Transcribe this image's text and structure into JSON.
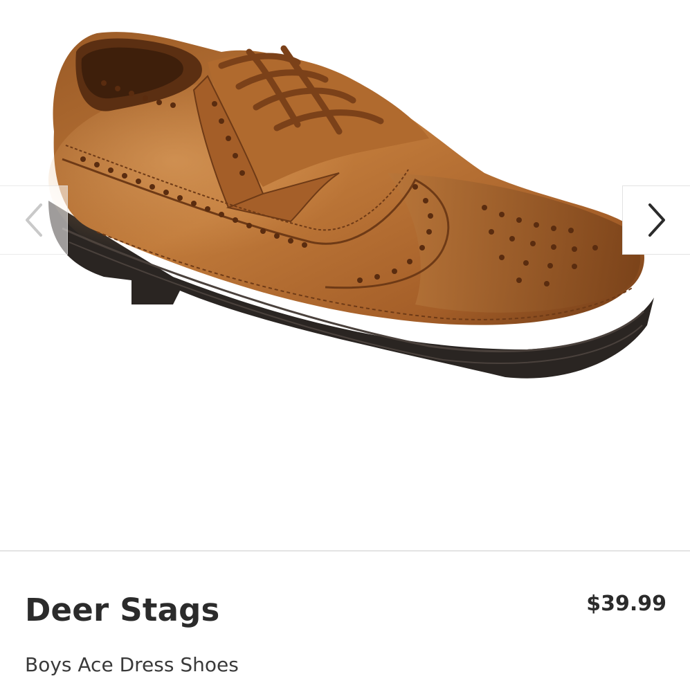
{
  "product": {
    "brand": "Deer Stags",
    "price": "$39.99",
    "name": "Boys Ace Dress Shoes",
    "image_icon": "brown-wingtip-dress-shoe-image"
  },
  "gallery": {
    "prev_icon": "chevron-left-icon",
    "next_icon": "chevron-right-icon"
  },
  "colors": {
    "leather": "#a8652e",
    "sole": "#2a2522",
    "text": "#2b2b2b"
  }
}
